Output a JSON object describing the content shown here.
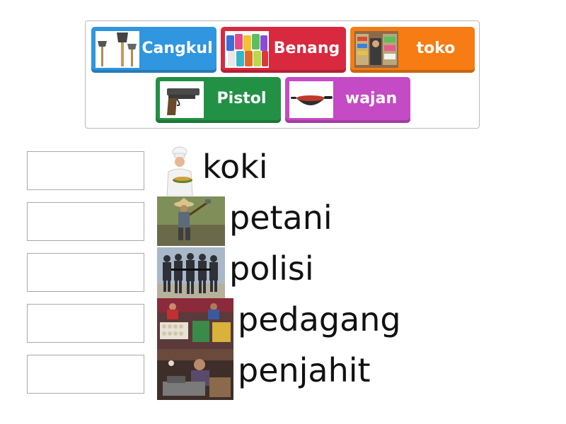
{
  "tiles": [
    {
      "label": "Cangkul",
      "color": "#2f96df",
      "icon": "hoe-icon"
    },
    {
      "label": "Benang",
      "color": "#d9293f",
      "icon": "thread-spools-icon"
    },
    {
      "label": "toko",
      "color": "#f67c13",
      "icon": "shop-icon"
    },
    {
      "label": "Pistol",
      "color": "#239145",
      "icon": "pistol-icon"
    },
    {
      "label": "wajan",
      "color": "#c54ac5",
      "icon": "wok-icon"
    }
  ],
  "targets": [
    {
      "label": "koki",
      "image": "chef-photo"
    },
    {
      "label": "petani",
      "image": "farmer-photo"
    },
    {
      "label": "polisi",
      "image": "police-photo"
    },
    {
      "label": "pedagang",
      "image": "trader-photo"
    },
    {
      "label": "penjahit",
      "image": "tailor-photo"
    }
  ]
}
